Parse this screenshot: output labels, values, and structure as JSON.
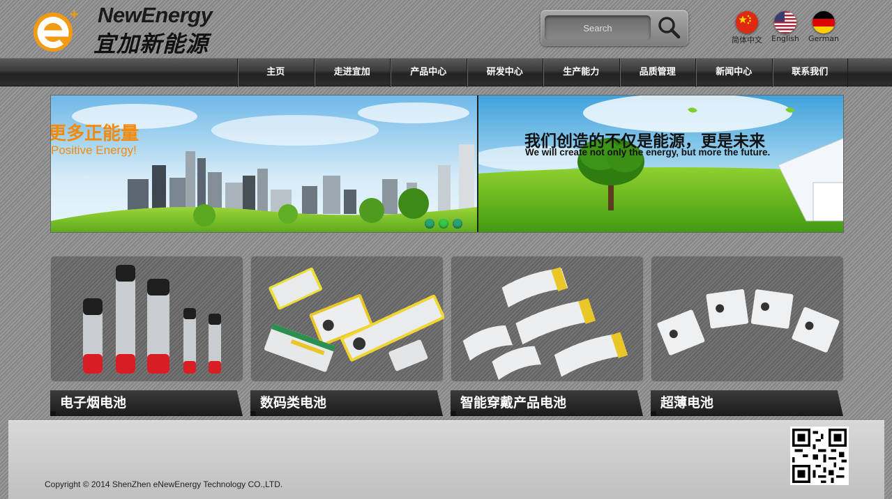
{
  "brand": {
    "name_en": "NewEnergy",
    "name_cn": "宜加新能源",
    "logo_letter": "e",
    "logo_plus": "+",
    "accent": "#f29a12"
  },
  "search": {
    "placeholder": "Search",
    "icon": "search-icon"
  },
  "languages": [
    {
      "label": "简体中文",
      "icon": "china-flag-icon"
    },
    {
      "label": "English",
      "icon": "usa-flag-icon"
    },
    {
      "label": "German",
      "icon": "germany-flag-icon"
    }
  ],
  "nav": [
    "主页",
    "走进宜加",
    "产品中心",
    "研发中心",
    "生产能力",
    "品质管理",
    "新闻中心",
    "联系我们"
  ],
  "banner": {
    "left_cn": "更多正能量",
    "left_en": "Positive Energy!",
    "right_cn": "我们创造的不仅是能源，更是未来",
    "right_en": "We will create not only the energy, but more the future.",
    "slide_count": 3,
    "active_slide": 2
  },
  "products": [
    {
      "label": "电子烟电池",
      "image": "cylindrical-batteries"
    },
    {
      "label": "数码类电池",
      "image": "pouch-batteries"
    },
    {
      "label": "智能穿戴产品电池",
      "image": "curved-batteries"
    },
    {
      "label": "超薄电池",
      "image": "ultra-thin-batteries"
    }
  ],
  "footer": {
    "copyright": "Copyright © 2014 ShenZhen eNewEnergy Technology CO.,LTD."
  }
}
